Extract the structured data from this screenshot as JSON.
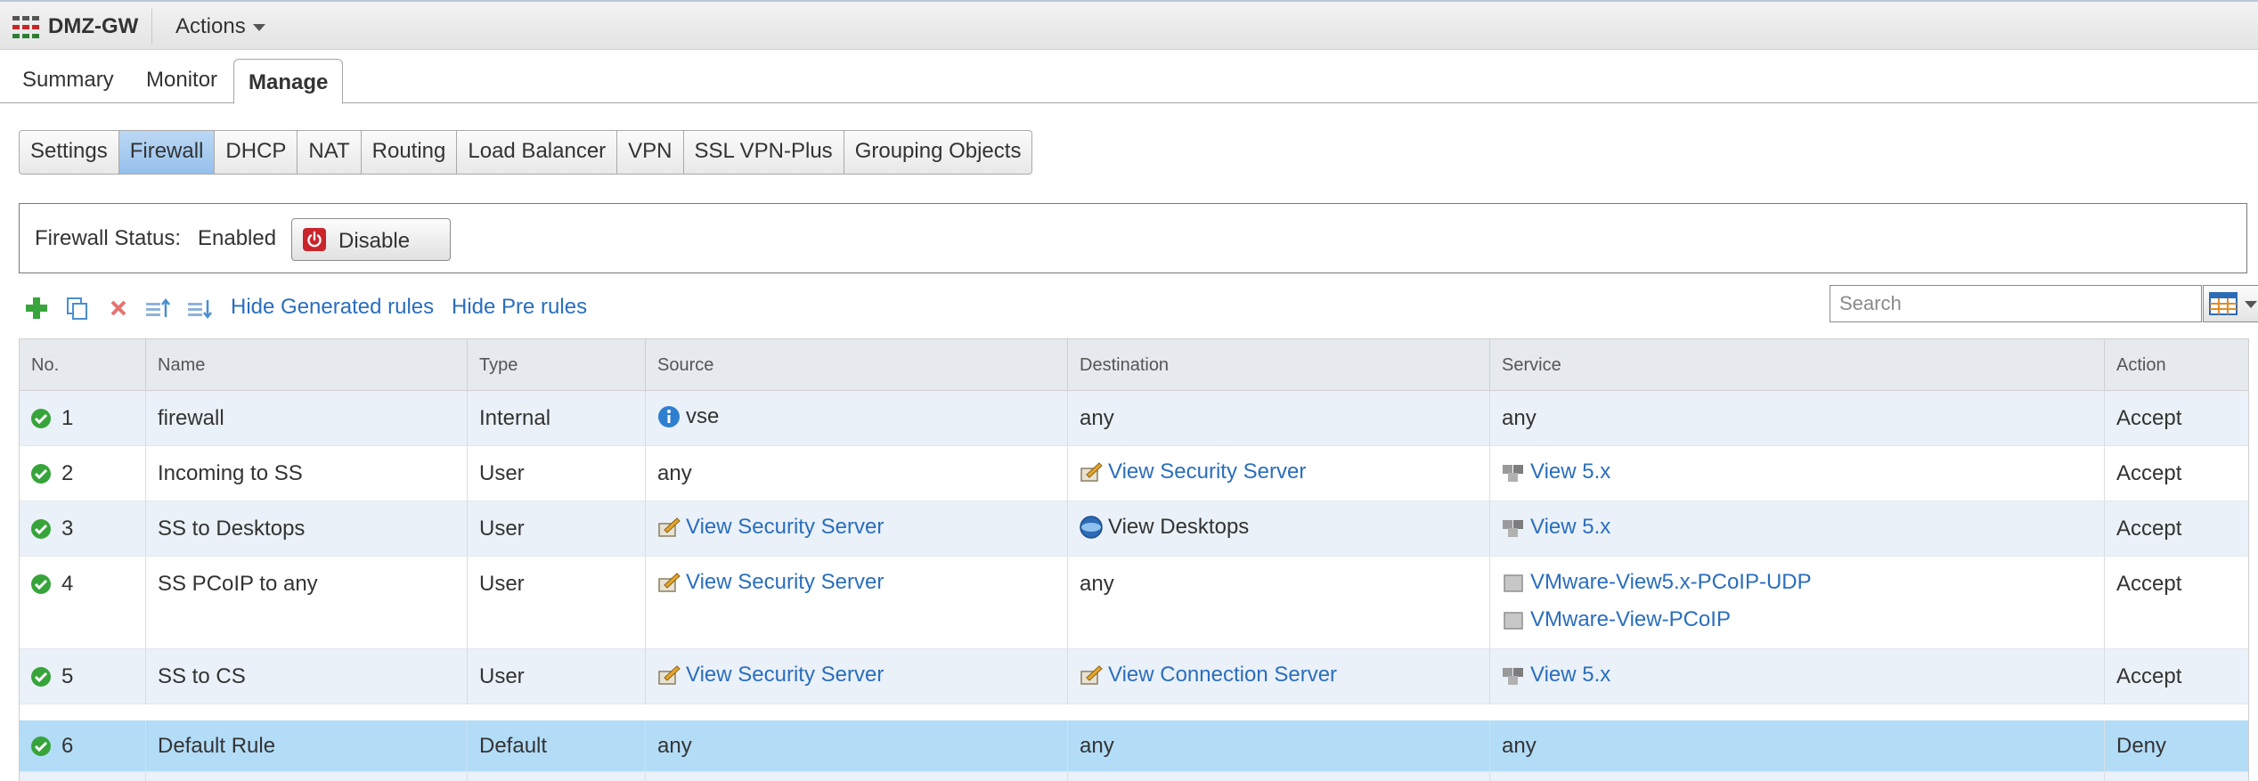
{
  "header": {
    "title": "DMZ-GW",
    "actions_label": "Actions"
  },
  "main_tabs": [
    {
      "label": "Summary"
    },
    {
      "label": "Monitor"
    },
    {
      "label": "Manage"
    }
  ],
  "sub_tabs": [
    {
      "label": "Settings"
    },
    {
      "label": "Firewall"
    },
    {
      "label": "DHCP"
    },
    {
      "label": "NAT"
    },
    {
      "label": "Routing"
    },
    {
      "label": "Load Balancer"
    },
    {
      "label": "VPN"
    },
    {
      "label": "SSL VPN-Plus"
    },
    {
      "label": "Grouping Objects"
    }
  ],
  "firewall": {
    "status_label": "Firewall Status:",
    "status_value": "Enabled",
    "disable_label": "Disable"
  },
  "toolbar": {
    "hide_generated": "Hide Generated rules",
    "hide_pre": "Hide Pre rules",
    "search_placeholder": "Search"
  },
  "table": {
    "columns": [
      "No.",
      "Name",
      "Type",
      "Source",
      "Destination",
      "Service",
      "Action"
    ],
    "rows": [
      {
        "no": "1",
        "name": "firewall",
        "type": "Internal",
        "source": "vse",
        "destination": "any",
        "service": [
          "any"
        ],
        "action": "Accept"
      },
      {
        "no": "2",
        "name": "Incoming to SS",
        "type": "User",
        "source": "any",
        "destination": "View Security Server",
        "service": [
          "View 5.x"
        ],
        "action": "Accept"
      },
      {
        "no": "3",
        "name": "SS to Desktops",
        "type": "User",
        "source": "View Security Server",
        "destination": "View Desktops",
        "service": [
          "View 5.x"
        ],
        "action": "Accept"
      },
      {
        "no": "4",
        "name": "SS PCoIP to any",
        "type": "User",
        "source": "View Security Server",
        "destination": "any",
        "service": [
          "VMware-View5.x-PCoIP-UDP",
          "VMware-View-PCoIP"
        ],
        "action": "Accept"
      },
      {
        "no": "5",
        "name": "SS to CS",
        "type": "User",
        "source": "View Security Server",
        "destination": "View Connection Server",
        "service": [
          "View 5.x"
        ],
        "action": "Accept"
      },
      {
        "no": "6",
        "name": "Default Rule",
        "type": "Default",
        "source": "any",
        "destination": "any",
        "service": [
          "any"
        ],
        "action": "Deny"
      }
    ]
  },
  "colors": {
    "link": "#2a6ebd",
    "selected_row": "#b3dcf7",
    "alt_row": "#eaf1f8",
    "active_subtab": "#94c0ec",
    "status_ok": "#37a43b"
  }
}
